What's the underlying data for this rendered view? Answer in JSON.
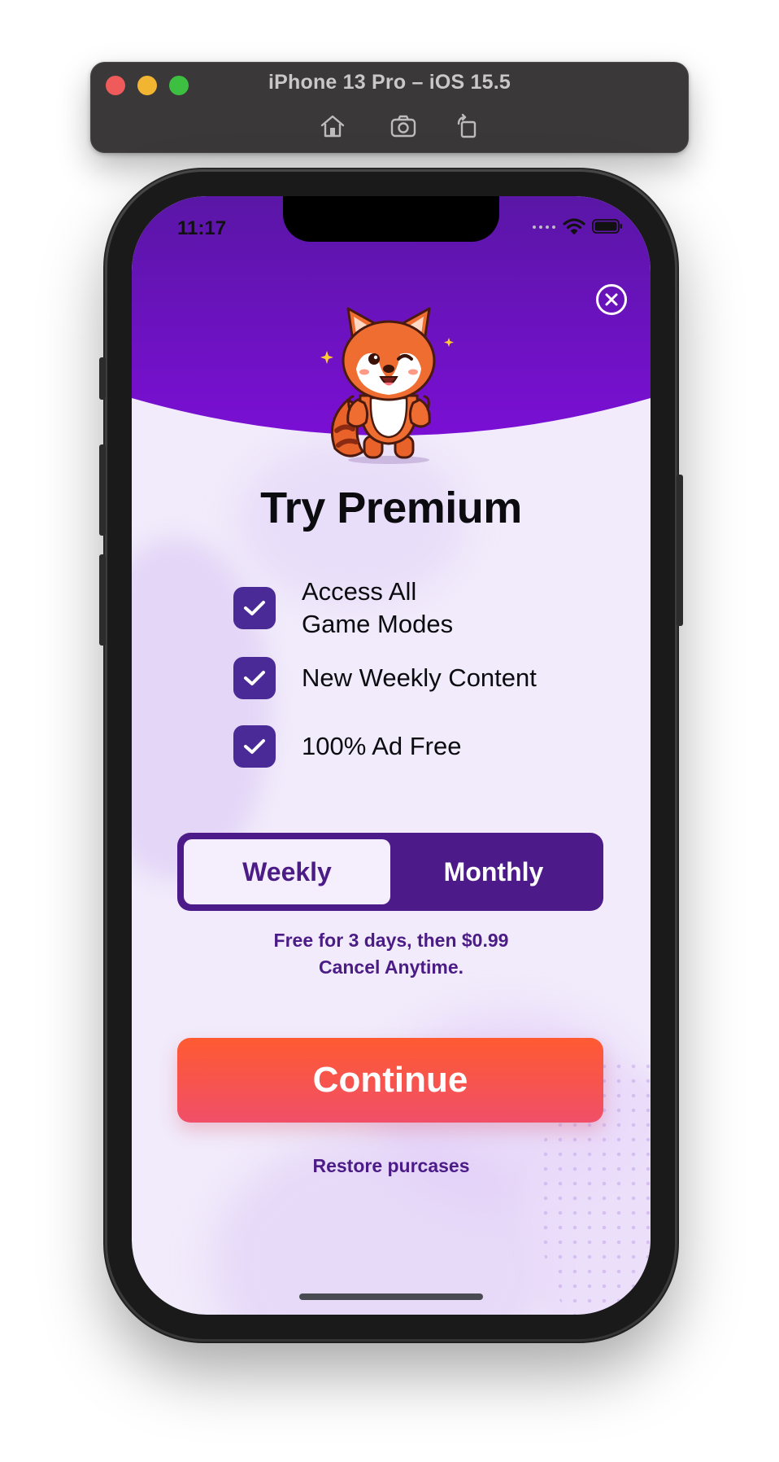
{
  "simulator": {
    "title": "iPhone 13 Pro – iOS 15.5",
    "buttons": [
      "home-icon",
      "screenshot-icon",
      "rotate-icon"
    ]
  },
  "status_bar": {
    "time": "11:17",
    "icons": [
      "signal-icon",
      "wifi-icon",
      "battery-icon"
    ]
  },
  "paywall": {
    "title": "Try Premium",
    "features": [
      {
        "line1": "Access All",
        "line2": "Game Modes"
      },
      {
        "line1": "New Weekly Content",
        "line2": ""
      },
      {
        "line1": "100% Ad Free",
        "line2": ""
      }
    ],
    "plans": {
      "weekly": "Weekly",
      "monthly": "Monthly",
      "selected": "weekly"
    },
    "terms_line1": "Free for 3 days, then $0.99",
    "terms_line2": "Cancel Anytime.",
    "continue_label": "Continue",
    "restore_label": "Restore purcases"
  },
  "colors": {
    "header_purple": "#6d14c4",
    "accent_purple": "#4d1a8a",
    "check_purple": "#4a2a96",
    "button_orange": "#ff5a32",
    "button_pink": "#f04f68",
    "background": "#f1ebfb"
  }
}
